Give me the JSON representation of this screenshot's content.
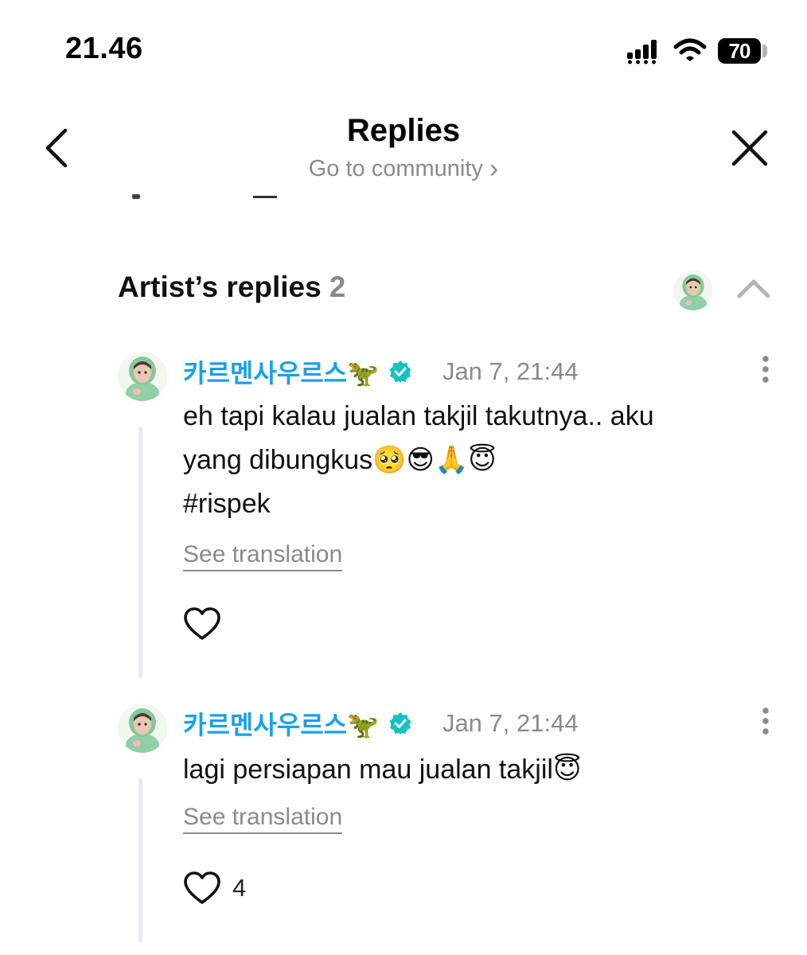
{
  "status_bar": {
    "time": "21.46",
    "battery_level": "70",
    "icons": [
      "signal-icon",
      "wifi-icon",
      "battery-icon"
    ]
  },
  "header": {
    "title": "Replies",
    "subtitle": "Go to community",
    "subtitle_chevron": "›",
    "back_icon": "chevron-left-icon",
    "close_icon": "close-icon"
  },
  "section": {
    "title": "Artist’s replies",
    "count": "2",
    "collapse_icon": "chevron-up-icon"
  },
  "replies": [
    {
      "username": "카르멘사우르스🦖",
      "timestamp": "Jan 7, 21:44",
      "lines": [
        "eh tapi kalau jualan takjil takutnya.. aku",
        "yang dibungkus🥺😎🙏😇",
        "#rispek"
      ],
      "translate_label": "See translation",
      "like_count": ""
    },
    {
      "username": "카르멘사우르스🦖",
      "timestamp": "Jan 7, 21:44",
      "lines": [
        "lagi persiapan mau jualan takjil😇"
      ],
      "translate_label": "See translation",
      "like_count": "4"
    }
  ],
  "colors": {
    "accent_username": "#1aa0ec",
    "verified_badge": "#16c2c2",
    "muted_text": "#8a8a8a",
    "thread_line": "#e8e8ee"
  }
}
